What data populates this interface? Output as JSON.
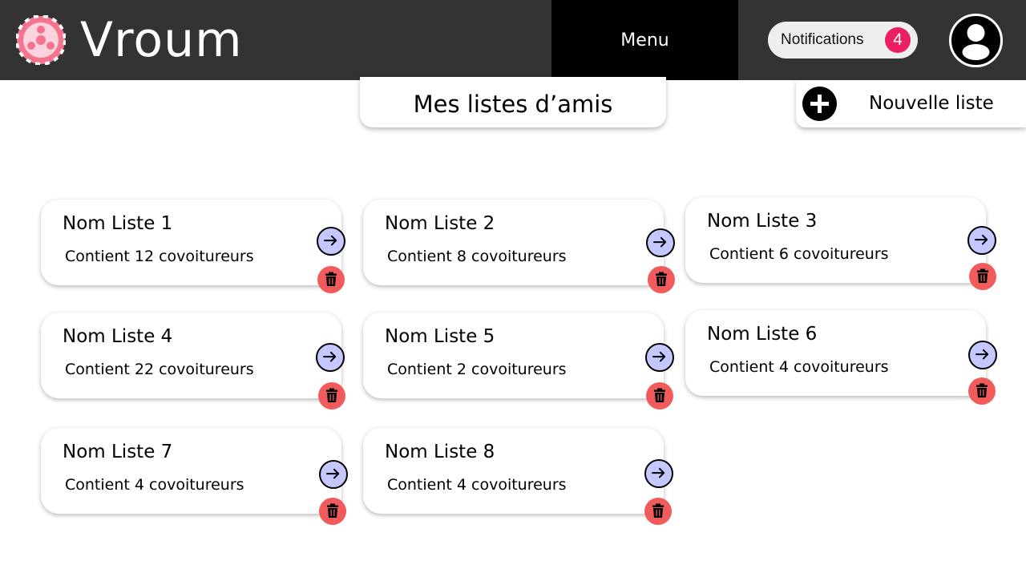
{
  "header": {
    "brand": "Vroum",
    "menu_label": "Menu",
    "notifications_label": "Notifications",
    "notifications_count": "4"
  },
  "page": {
    "title": "Mes listes d’amis",
    "new_list_label": "Nouvelle liste"
  },
  "colors": {
    "header_bg": "#333333",
    "menu_bg": "#000000",
    "badge": "#e91e63",
    "open_button": "#c5c8ff",
    "delete_button": "#f15b5b"
  },
  "icons": {
    "logo": "steering-wheel-icon",
    "avatar": "user-icon",
    "new_list": "plus-icon",
    "open": "arrow-right-circle-icon",
    "delete": "trash-icon"
  },
  "lists": [
    {
      "name": "Nom Liste 1",
      "count": "Contient 12 covoitureurs"
    },
    {
      "name": "Nom Liste 2",
      "count": "Contient 8 covoitureurs"
    },
    {
      "name": "Nom Liste 3",
      "count": "Contient 6 covoitureurs"
    },
    {
      "name": "Nom Liste 4",
      "count": "Contient 22 covoitureurs"
    },
    {
      "name": "Nom Liste 5",
      "count": "Contient 2 covoitureurs"
    },
    {
      "name": "Nom Liste 6",
      "count": "Contient 4 covoitureurs"
    },
    {
      "name": "Nom Liste 7",
      "count": "Contient 4 covoitureurs"
    },
    {
      "name": "Nom Liste 8",
      "count": "Contient 4 covoitureurs"
    }
  ]
}
